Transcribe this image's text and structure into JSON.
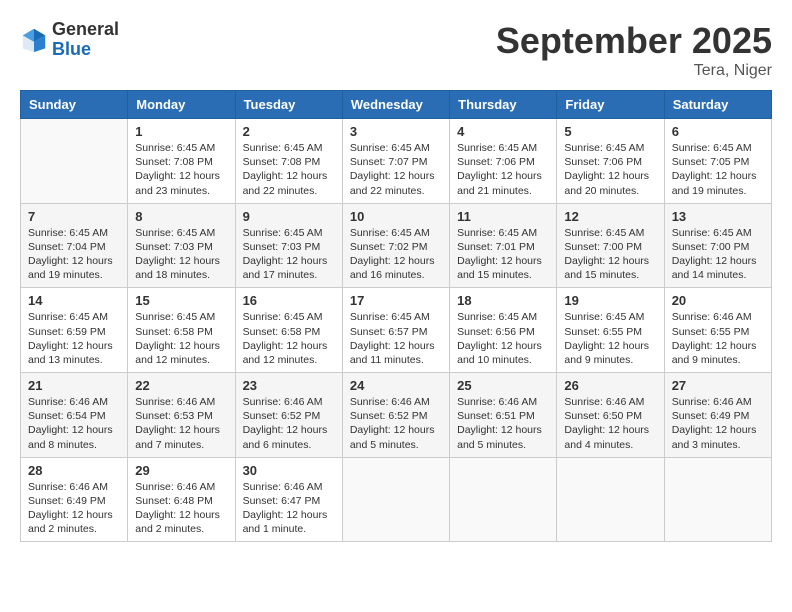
{
  "header": {
    "logo_general": "General",
    "logo_blue": "Blue",
    "month_title": "September 2025",
    "location": "Tera, Niger"
  },
  "days_of_week": [
    "Sunday",
    "Monday",
    "Tuesday",
    "Wednesday",
    "Thursday",
    "Friday",
    "Saturday"
  ],
  "weeks": [
    [
      {
        "day": "",
        "info": ""
      },
      {
        "day": "1",
        "info": "Sunrise: 6:45 AM\nSunset: 7:08 PM\nDaylight: 12 hours\nand 23 minutes."
      },
      {
        "day": "2",
        "info": "Sunrise: 6:45 AM\nSunset: 7:08 PM\nDaylight: 12 hours\nand 22 minutes."
      },
      {
        "day": "3",
        "info": "Sunrise: 6:45 AM\nSunset: 7:07 PM\nDaylight: 12 hours\nand 22 minutes."
      },
      {
        "day": "4",
        "info": "Sunrise: 6:45 AM\nSunset: 7:06 PM\nDaylight: 12 hours\nand 21 minutes."
      },
      {
        "day": "5",
        "info": "Sunrise: 6:45 AM\nSunset: 7:06 PM\nDaylight: 12 hours\nand 20 minutes."
      },
      {
        "day": "6",
        "info": "Sunrise: 6:45 AM\nSunset: 7:05 PM\nDaylight: 12 hours\nand 19 minutes."
      }
    ],
    [
      {
        "day": "7",
        "info": "Sunrise: 6:45 AM\nSunset: 7:04 PM\nDaylight: 12 hours\nand 19 minutes."
      },
      {
        "day": "8",
        "info": "Sunrise: 6:45 AM\nSunset: 7:03 PM\nDaylight: 12 hours\nand 18 minutes."
      },
      {
        "day": "9",
        "info": "Sunrise: 6:45 AM\nSunset: 7:03 PM\nDaylight: 12 hours\nand 17 minutes."
      },
      {
        "day": "10",
        "info": "Sunrise: 6:45 AM\nSunset: 7:02 PM\nDaylight: 12 hours\nand 16 minutes."
      },
      {
        "day": "11",
        "info": "Sunrise: 6:45 AM\nSunset: 7:01 PM\nDaylight: 12 hours\nand 15 minutes."
      },
      {
        "day": "12",
        "info": "Sunrise: 6:45 AM\nSunset: 7:00 PM\nDaylight: 12 hours\nand 15 minutes."
      },
      {
        "day": "13",
        "info": "Sunrise: 6:45 AM\nSunset: 7:00 PM\nDaylight: 12 hours\nand 14 minutes."
      }
    ],
    [
      {
        "day": "14",
        "info": "Sunrise: 6:45 AM\nSunset: 6:59 PM\nDaylight: 12 hours\nand 13 minutes."
      },
      {
        "day": "15",
        "info": "Sunrise: 6:45 AM\nSunset: 6:58 PM\nDaylight: 12 hours\nand 12 minutes."
      },
      {
        "day": "16",
        "info": "Sunrise: 6:45 AM\nSunset: 6:58 PM\nDaylight: 12 hours\nand 12 minutes."
      },
      {
        "day": "17",
        "info": "Sunrise: 6:45 AM\nSunset: 6:57 PM\nDaylight: 12 hours\nand 11 minutes."
      },
      {
        "day": "18",
        "info": "Sunrise: 6:45 AM\nSunset: 6:56 PM\nDaylight: 12 hours\nand 10 minutes."
      },
      {
        "day": "19",
        "info": "Sunrise: 6:45 AM\nSunset: 6:55 PM\nDaylight: 12 hours\nand 9 minutes."
      },
      {
        "day": "20",
        "info": "Sunrise: 6:46 AM\nSunset: 6:55 PM\nDaylight: 12 hours\nand 9 minutes."
      }
    ],
    [
      {
        "day": "21",
        "info": "Sunrise: 6:46 AM\nSunset: 6:54 PM\nDaylight: 12 hours\nand 8 minutes."
      },
      {
        "day": "22",
        "info": "Sunrise: 6:46 AM\nSunset: 6:53 PM\nDaylight: 12 hours\nand 7 minutes."
      },
      {
        "day": "23",
        "info": "Sunrise: 6:46 AM\nSunset: 6:52 PM\nDaylight: 12 hours\nand 6 minutes."
      },
      {
        "day": "24",
        "info": "Sunrise: 6:46 AM\nSunset: 6:52 PM\nDaylight: 12 hours\nand 5 minutes."
      },
      {
        "day": "25",
        "info": "Sunrise: 6:46 AM\nSunset: 6:51 PM\nDaylight: 12 hours\nand 5 minutes."
      },
      {
        "day": "26",
        "info": "Sunrise: 6:46 AM\nSunset: 6:50 PM\nDaylight: 12 hours\nand 4 minutes."
      },
      {
        "day": "27",
        "info": "Sunrise: 6:46 AM\nSunset: 6:49 PM\nDaylight: 12 hours\nand 3 minutes."
      }
    ],
    [
      {
        "day": "28",
        "info": "Sunrise: 6:46 AM\nSunset: 6:49 PM\nDaylight: 12 hours\nand 2 minutes."
      },
      {
        "day": "29",
        "info": "Sunrise: 6:46 AM\nSunset: 6:48 PM\nDaylight: 12 hours\nand 2 minutes."
      },
      {
        "day": "30",
        "info": "Sunrise: 6:46 AM\nSunset: 6:47 PM\nDaylight: 12 hours\nand 1 minute."
      },
      {
        "day": "",
        "info": ""
      },
      {
        "day": "",
        "info": ""
      },
      {
        "day": "",
        "info": ""
      },
      {
        "day": "",
        "info": ""
      }
    ]
  ]
}
